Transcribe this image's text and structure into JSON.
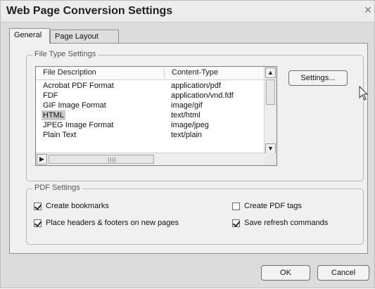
{
  "window": {
    "title": "Web Page Conversion Settings"
  },
  "tabs": [
    {
      "label": "General",
      "active": true
    },
    {
      "label": "Page Layout",
      "active": false
    }
  ],
  "file_type_settings": {
    "group_label": "File Type Settings",
    "columns": [
      "File Description",
      "Content-Type"
    ],
    "rows": [
      {
        "description": "Acrobat PDF Format",
        "content_type": "application/pdf"
      },
      {
        "description": "FDF",
        "content_type": "application/vnd.fdf"
      },
      {
        "description": "GIF Image Format",
        "content_type": "image/gif"
      },
      {
        "description": "HTML",
        "content_type": "text/html",
        "selected": true
      },
      {
        "description": "JPEG Image Format",
        "content_type": "image/jpeg"
      },
      {
        "description": "Plain Text",
        "content_type": "text/plain"
      }
    ],
    "settings_button": "Settings..."
  },
  "pdf_settings": {
    "group_label": "PDF Settings",
    "checkboxes": [
      {
        "label": "Create bookmarks",
        "checked": true
      },
      {
        "label": "Place headers & footers on new pages",
        "checked": true
      },
      {
        "label": "Create PDF tags",
        "checked": false
      },
      {
        "label": "Save refresh commands",
        "checked": true
      }
    ]
  },
  "buttons": {
    "ok": "OK",
    "cancel": "Cancel"
  }
}
